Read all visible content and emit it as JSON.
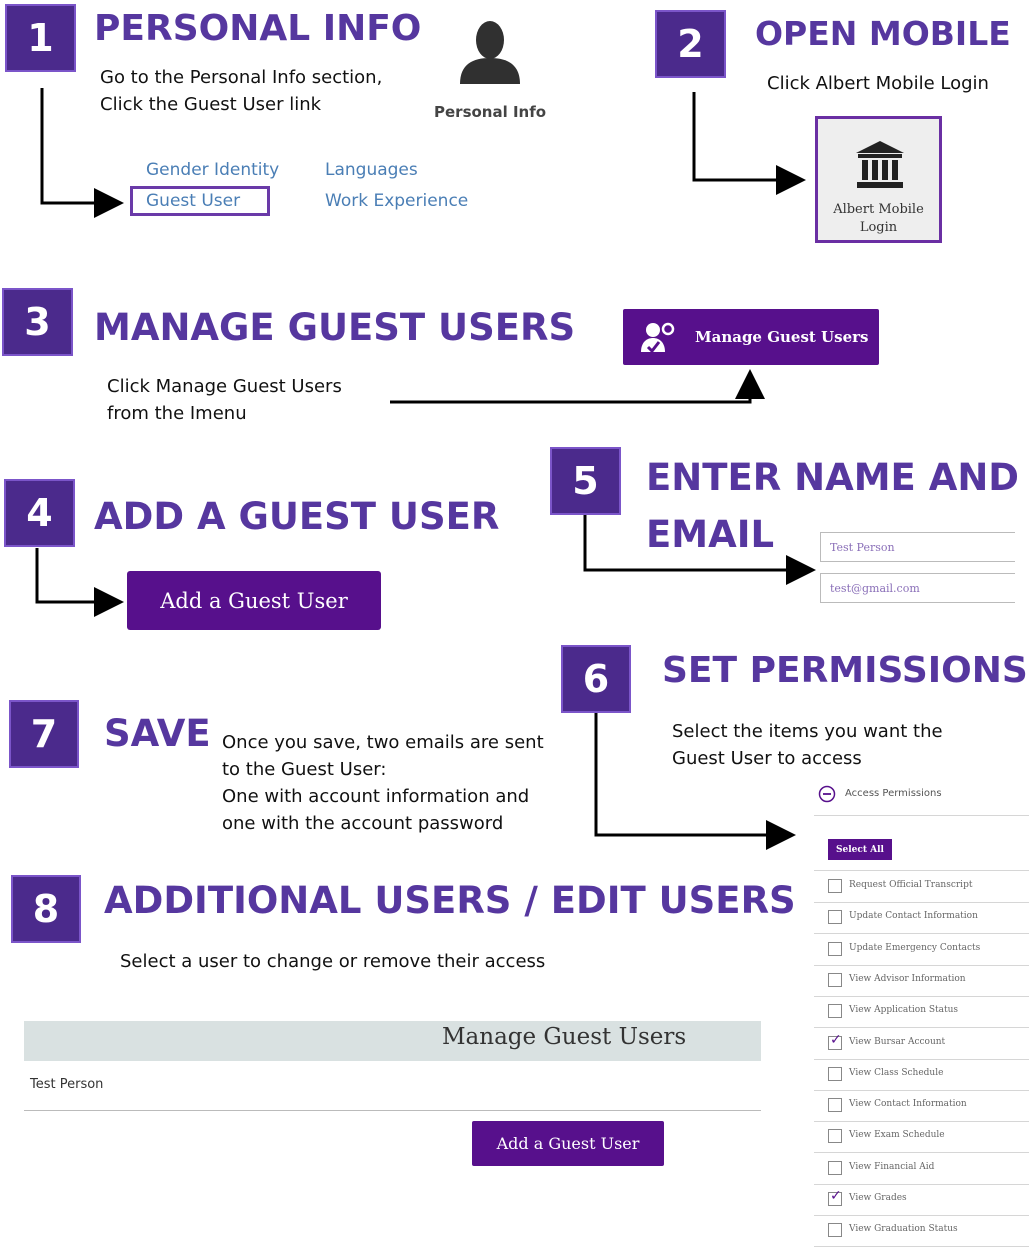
{
  "step1": {
    "number": "1",
    "title": "PERSONAL INFO",
    "line1": "Go to the Personal Info section,",
    "line2": "Click the Guest User  link",
    "icon_label": "Personal Info",
    "links": [
      "Gender Identity",
      "Languages",
      "Guest User",
      "Work Experience"
    ]
  },
  "step2": {
    "number": "2",
    "title": "OPEN MOBILE",
    "text": "Click Albert Mobile Login",
    "tile_line1": "Albert Mobile",
    "tile_line2": "Login"
  },
  "step3": {
    "number": "3",
    "title": "MANAGE GUEST USERS",
    "line1": "Click Manage Guest Users",
    "line2": "from the Imenu",
    "button": "Manage Guest Users"
  },
  "step4": {
    "number": "4",
    "title": "ADD A GUEST USER",
    "button": "Add a Guest User"
  },
  "step5": {
    "number": "5",
    "title_line1": "ENTER NAME AND",
    "title_line2": "EMAIL",
    "name_value": "Test Person",
    "email_value": "test@gmail.com"
  },
  "step6": {
    "number": "6",
    "title": "SET PERMISSIONS",
    "line1": "Select the items you want the",
    "line2": "Guest User to access",
    "section_label": "Access Permissions",
    "select_all": "Select All",
    "items": [
      {
        "label": "Request Official Transcript",
        "checked": false
      },
      {
        "label": "Update Contact Information",
        "checked": false
      },
      {
        "label": "Update Emergency Contacts",
        "checked": false
      },
      {
        "label": "View Advisor Information",
        "checked": false
      },
      {
        "label": "View Application Status",
        "checked": false
      },
      {
        "label": "View Bursar Account",
        "checked": true
      },
      {
        "label": "View Class Schedule",
        "checked": false
      },
      {
        "label": "View Contact Information",
        "checked": false
      },
      {
        "label": "View Exam Schedule",
        "checked": false
      },
      {
        "label": "View Financial Aid",
        "checked": false
      },
      {
        "label": "View Grades",
        "checked": true
      },
      {
        "label": "View Graduation Status",
        "checked": false
      }
    ]
  },
  "step7": {
    "number": "7",
    "title": "SAVE",
    "line1": "Once you save, two emails are sent",
    "line2": "to the Guest User:",
    "line3": "One with account information and",
    "line4": "one with the account password"
  },
  "step8": {
    "number": "8",
    "title": "ADDITIONAL USERS / EDIT USERS",
    "text": "Select a user to change or remove their access",
    "panel_title": "Manage Guest Users",
    "row": "Test Person",
    "button": "Add a Guest User"
  },
  "colors": {
    "accent": "#56379f",
    "number_bg": "#4b2a8c",
    "button_purple": "#57108c",
    "link_blue": "#4a7eb5"
  }
}
